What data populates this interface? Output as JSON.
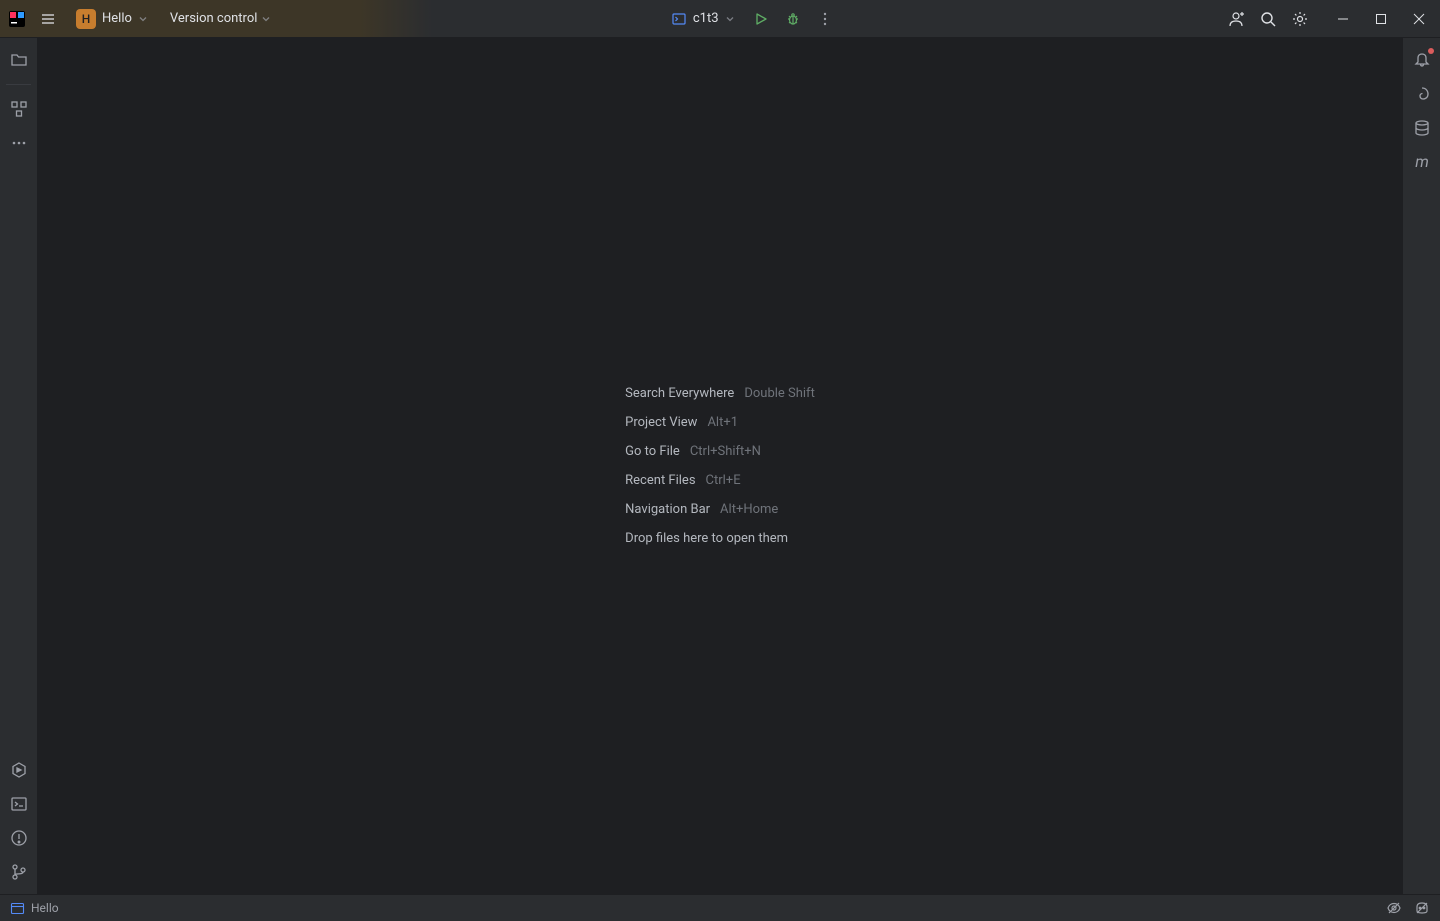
{
  "titlebar": {
    "project_badge": "H",
    "project_name": "Hello",
    "vcs_label": "Version control",
    "run_config": "c1t3"
  },
  "welcome": {
    "rows": [
      {
        "label": "Search Everywhere",
        "shortcut": "Double Shift"
      },
      {
        "label": "Project View",
        "shortcut": "Alt+1"
      },
      {
        "label": "Go to File",
        "shortcut": "Ctrl+Shift+N"
      },
      {
        "label": "Recent Files",
        "shortcut": "Ctrl+E"
      },
      {
        "label": "Navigation Bar",
        "shortcut": "Alt+Home"
      }
    ],
    "drop_hint": "Drop files here to open them"
  },
  "statusbar": {
    "project": "Hello"
  }
}
